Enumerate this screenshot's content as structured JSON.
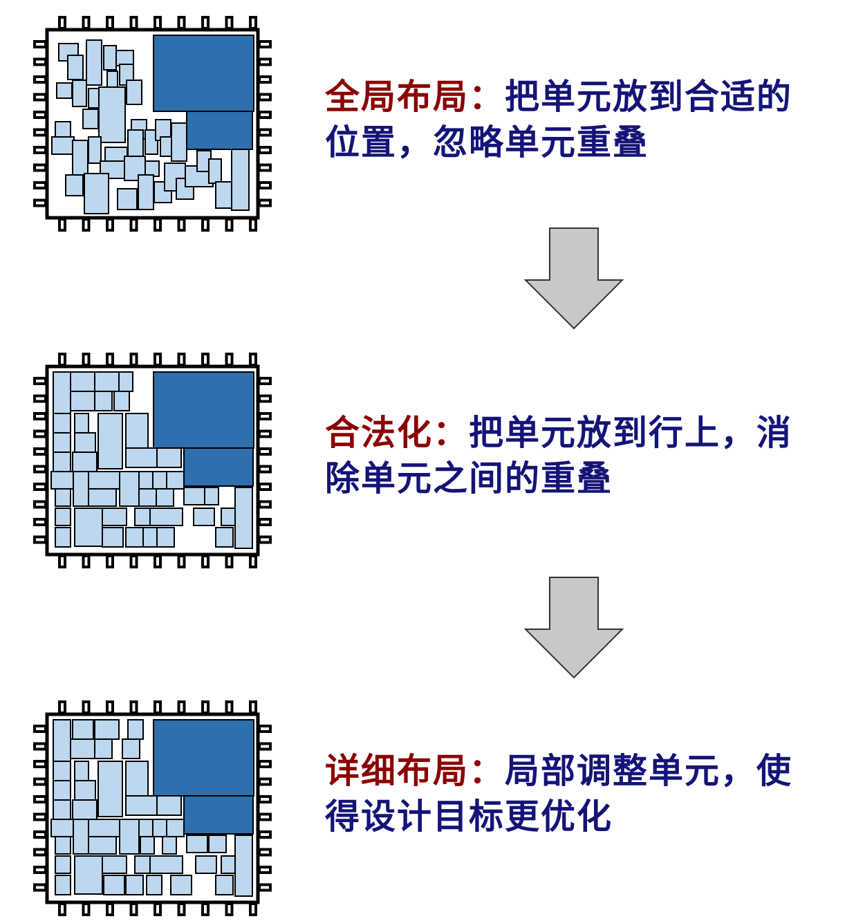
{
  "colors": {
    "label": "#8b0000",
    "description": "#141478",
    "cell_fill": "#bcd7ee",
    "macro_fill": "#2e6fae",
    "arrow_fill": "#c8c8c8"
  },
  "stages": [
    {
      "label": "全局布局：",
      "description_line1": "把单元放到合适的",
      "description_line2": "位置，忽略单元重叠"
    },
    {
      "label": "合法化：",
      "description_line1": "把单元放到行上，消",
      "description_line2": "除单元之间的重叠"
    },
    {
      "label": "详细布局：",
      "description_line1": "局部调整单元，使",
      "description_line2": "得设计目标更优化"
    }
  ]
}
